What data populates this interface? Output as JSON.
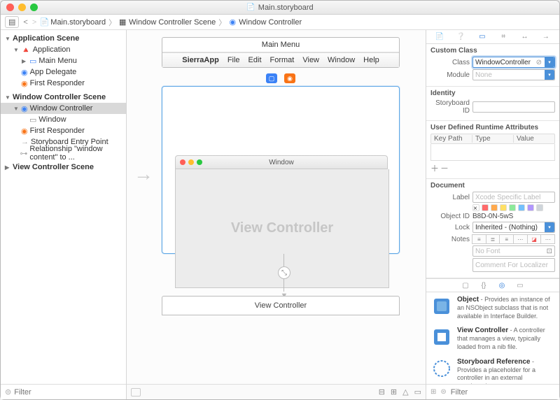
{
  "title": "Main.storyboard",
  "crumb": [
    "Main.storyboard",
    "Window Controller Scene",
    "Window Controller"
  ],
  "outline": {
    "scenes": [
      {
        "label": "Application Scene",
        "id": "application-scene",
        "items": [
          {
            "label": "Application",
            "icon": "app",
            "children": [
              {
                "label": "Main Menu",
                "icon": "menu"
              }
            ]
          },
          {
            "label": "App Delegate",
            "icon": "delegate"
          },
          {
            "label": "First Responder",
            "icon": "responder"
          }
        ]
      },
      {
        "label": "Window Controller Scene",
        "id": "window-controller-scene",
        "items": [
          {
            "label": "Window Controller",
            "icon": "wc",
            "selected": true,
            "children": [
              {
                "label": "Window",
                "icon": "window"
              }
            ]
          },
          {
            "label": "First Responder",
            "icon": "responder"
          },
          {
            "label": "Storyboard Entry Point",
            "icon": "entry"
          },
          {
            "label": "Relationship \"window content\" to ...",
            "icon": "relationship"
          }
        ]
      },
      {
        "label": "View Controller Scene",
        "id": "view-controller-scene",
        "items": []
      }
    ],
    "filter_placeholder": "Filter"
  },
  "canvas": {
    "menu": {
      "title": "Main Menu",
      "items": [
        "SierraApp",
        "File",
        "Edit",
        "Format",
        "View",
        "Window",
        "Help"
      ]
    },
    "window_title": "Window",
    "vc_placeholder": "View Controller",
    "vc_below": "View Controller"
  },
  "inspector": {
    "custom_class": {
      "title": "Custom Class",
      "class": "WindowController",
      "module_placeholder": "None"
    },
    "identity": {
      "title": "Identity",
      "storyboard_id": ""
    },
    "udra": {
      "title": "User Defined Runtime Attributes",
      "cols": [
        "Key Path",
        "Type",
        "Value"
      ]
    },
    "document": {
      "title": "Document",
      "label_placeholder": "Xcode Specific Label",
      "object_id": "B8D-0N-5wS",
      "lock": "Inherited - (Nothing)",
      "no_font": "No Font",
      "notes_placeholder": "Comment For Localizer"
    },
    "labels": {
      "class": "Class",
      "module": "Module",
      "storyboard_id": "Storyboard ID",
      "label": "Label",
      "object_id": "Object ID",
      "lock": "Lock",
      "notes": "Notes"
    },
    "library": [
      {
        "name": "Object",
        "desc": " - Provides an instance of an NSObject subclass that is not available in Interface Builder."
      },
      {
        "name": "View Controller",
        "desc": " - A controller that manages a view, typically loaded from a nib file."
      },
      {
        "name": "Storyboard Reference",
        "desc": " - Provides a placeholder for a controller in an external storyboard."
      }
    ],
    "filter_placeholder": "Filter"
  }
}
